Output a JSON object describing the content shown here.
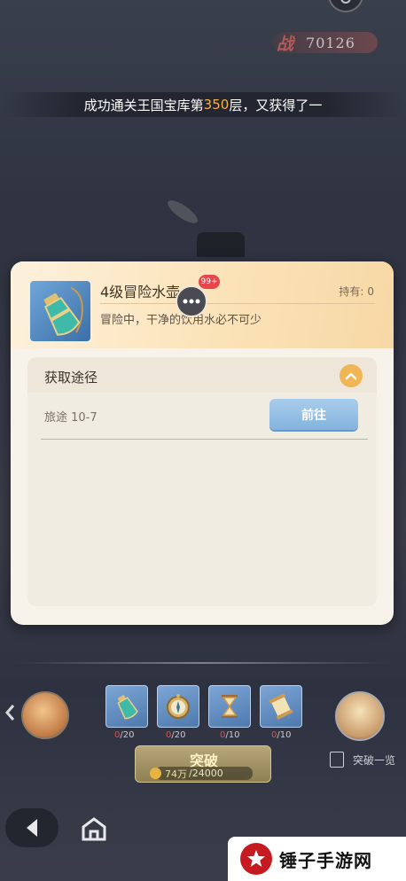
{
  "top": {
    "power_label": "战",
    "power_value": "70126",
    "announcement": {
      "prefix": "成功通关王国宝库第",
      "floor": "350",
      "suffix": "层，又获得了一"
    }
  },
  "popup": {
    "item_name": "4级冒险水壶",
    "owned_label": "持有:",
    "owned_value": "0",
    "description": "冒险中，干净的饮用水必不可少",
    "sources_title": "获取途径",
    "sources": [
      {
        "location": "旅途 10-7",
        "button": "前往"
      }
    ]
  },
  "chat": {
    "badge": "99+"
  },
  "materials": [
    {
      "icon": "water-flask-icon",
      "have": "0",
      "need": "/20"
    },
    {
      "icon": "compass-icon",
      "have": "0",
      "need": "/20"
    },
    {
      "icon": "hourglass-icon",
      "have": "0",
      "need": "/10"
    },
    {
      "icon": "scroll-icon",
      "have": "0",
      "need": "/10"
    }
  ],
  "breakthrough": {
    "label": "突破",
    "owned": "74万",
    "cost": "/24000"
  },
  "overview_label": "突破一览",
  "watermark": "锤子手游网",
  "colors": {
    "accent_orange": "#f0b555",
    "go_button": "#84b3dd",
    "insufficient": "#e05050",
    "highlight": "#f5b040"
  }
}
